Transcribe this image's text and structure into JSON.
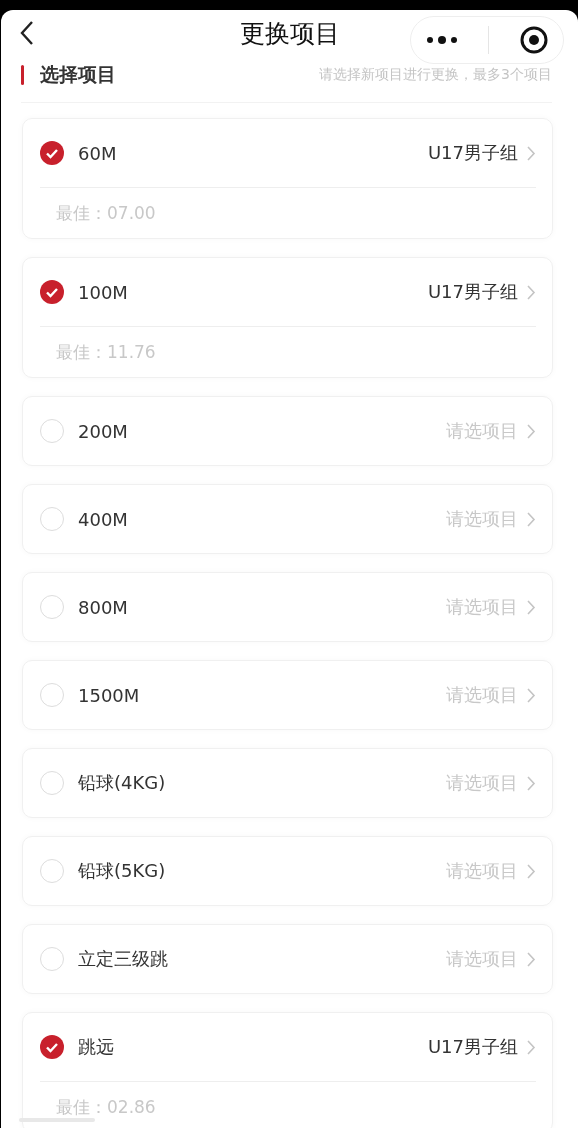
{
  "header": {
    "title": "更换项目"
  },
  "section": {
    "title": "选择项目",
    "hint": "请选择新项目进行更换，最多3个项目"
  },
  "events": [
    {
      "name": "60M",
      "checked": true,
      "group": "U17男子组",
      "best": "最佳：07.00"
    },
    {
      "name": "100M",
      "checked": true,
      "group": "U17男子组",
      "best": "最佳：11.76"
    },
    {
      "name": "200M",
      "checked": false,
      "placeholder": "请选项目"
    },
    {
      "name": "400M",
      "checked": false,
      "placeholder": "请选项目"
    },
    {
      "name": "800M",
      "checked": false,
      "placeholder": "请选项目"
    },
    {
      "name": "1500M",
      "checked": false,
      "placeholder": "请选项目"
    },
    {
      "name": "铅球(4KG)",
      "checked": false,
      "placeholder": "请选项目"
    },
    {
      "name": "铅球(5KG)",
      "checked": false,
      "placeholder": "请选项目"
    },
    {
      "name": "立定三级跳",
      "checked": false,
      "placeholder": "请选项目"
    },
    {
      "name": "跳远",
      "checked": true,
      "group": "U17男子组",
      "best": "最佳：02.86"
    }
  ]
}
